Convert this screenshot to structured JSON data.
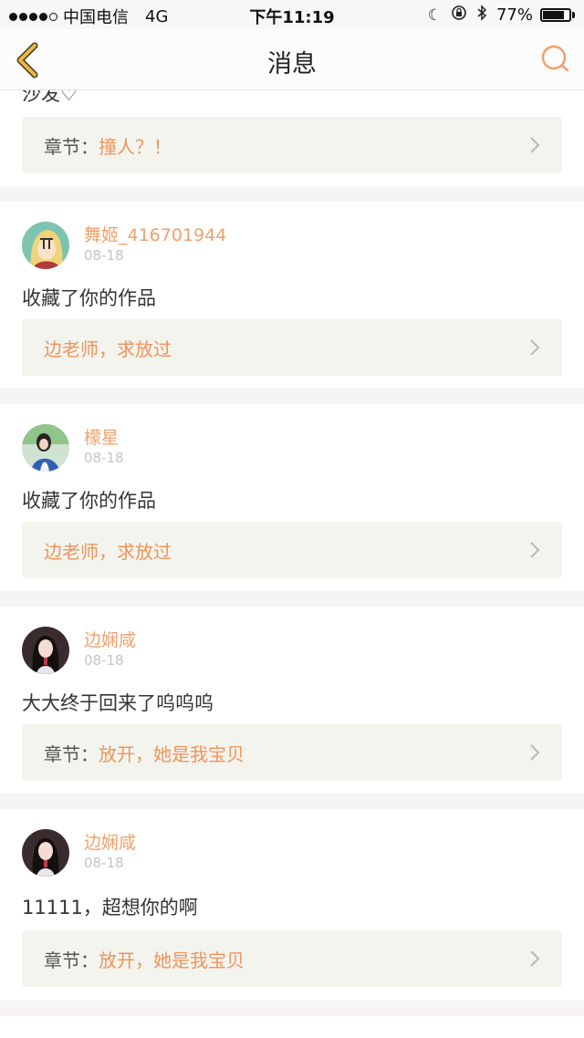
{
  "status_bar": {
    "carrier": "中国电信",
    "network": "4G",
    "time": "下午11:19",
    "battery": "77%"
  },
  "header": {
    "title": "消息"
  },
  "partial_comment": "沙发♡",
  "partial_chapter": {
    "prefix": "章节：",
    "title": "撞人？！"
  },
  "messages": [
    {
      "username": "舞姬_416701944",
      "date": "08-18",
      "comment": "收藏了你的作品",
      "chapter_prefix": "",
      "work_title": "边老师，求放过"
    },
    {
      "username": "檬星",
      "date": "08-18",
      "comment": "收藏了你的作品",
      "chapter_prefix": "",
      "work_title": "边老师，求放过"
    },
    {
      "username": "边娴咸",
      "date": "08-18",
      "comment": "大大终于回来了呜呜呜",
      "chapter_prefix": "章节：",
      "work_title": "放开，她是我宝贝"
    },
    {
      "username": "边娴咸",
      "date": "08-18",
      "comment": "11111，超想你的啊",
      "chapter_prefix": "章节：",
      "work_title": "放开，她是我宝贝"
    }
  ],
  "colors": {
    "accent": "#f0a06a",
    "chapter_bg": "#f4f4ee",
    "back_arrow": "#e8b94a"
  }
}
